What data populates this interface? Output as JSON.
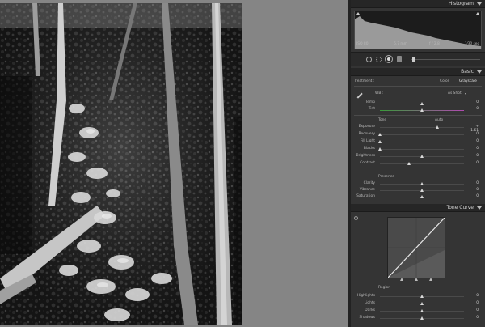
{
  "histogram": {
    "title": "Histogram",
    "info": {
      "iso": "ISO 80",
      "focal": "6.7 mm",
      "aperture": "f / 2.8",
      "shutter": "1⁄30 sec"
    }
  },
  "basic": {
    "title": "Basic",
    "treatment_label": "Treatment :",
    "treatment_color": "Color",
    "treatment_gray": "Grayscale",
    "wb_label": "WB :",
    "wb_value": "As Shot",
    "temp_label": "Temp",
    "tint_label": "Tint",
    "temp_value": "0",
    "tint_value": "0",
    "tone_label": "Tone",
    "auto_label": "Auto",
    "sliders": [
      {
        "label": "Exposure",
        "value": "+ 1.61",
        "pos": 0.68
      },
      {
        "label": "Recovery",
        "value": "0",
        "pos": 0.0
      },
      {
        "label": "Fill Light",
        "value": "0",
        "pos": 0.0
      },
      {
        "label": "Blacks",
        "value": "0",
        "pos": 0.0
      },
      {
        "label": "Brightness",
        "value": "0",
        "pos": 0.5
      },
      {
        "label": "Contrast",
        "value": "0",
        "pos": 0.35
      }
    ],
    "presence_label": "Presence",
    "presence": [
      {
        "label": "Clarity",
        "value": "0",
        "pos": 0.5
      },
      {
        "label": "Vibrance",
        "value": "0",
        "pos": 0.5
      },
      {
        "label": "Saturation",
        "value": "0",
        "pos": 0.5
      }
    ]
  },
  "tone_curve": {
    "title": "Tone Curve",
    "region_label": "Region",
    "regions": [
      {
        "label": "Highlights",
        "value": "0",
        "pos": 0.5
      },
      {
        "label": "Lights",
        "value": "0",
        "pos": 0.5
      },
      {
        "label": "Darks",
        "value": "0",
        "pos": 0.5
      },
      {
        "label": "Shadows",
        "value": "0",
        "pos": 0.5
      }
    ]
  }
}
